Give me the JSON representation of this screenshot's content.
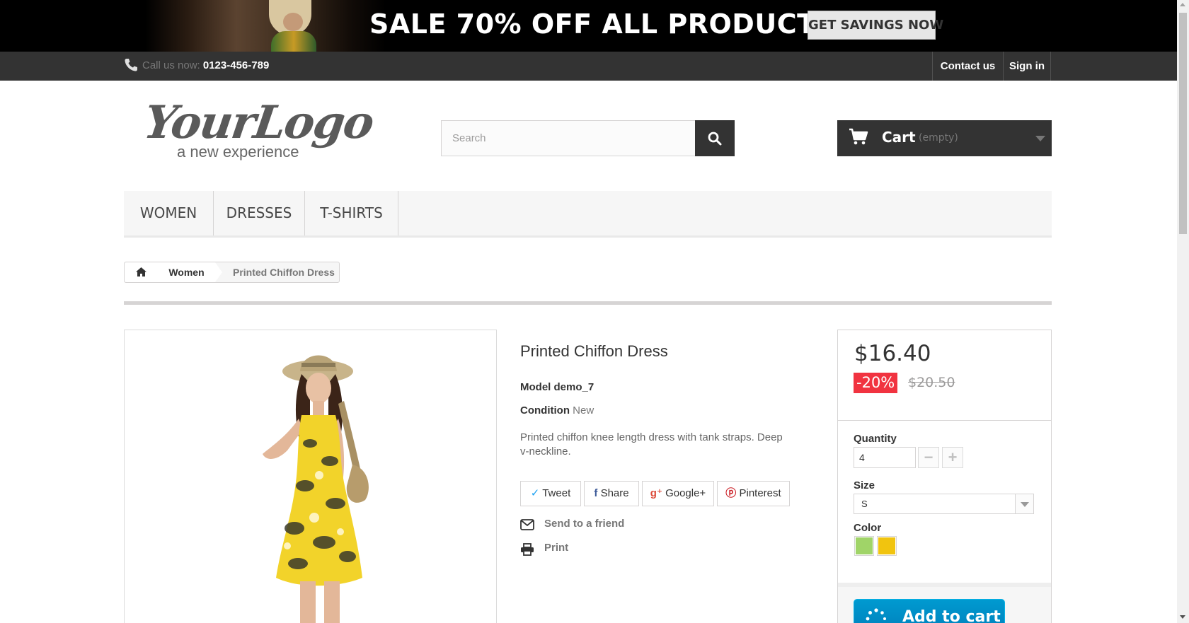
{
  "banner": {
    "headline": "SALE 70% OFF ALL PRODUCTS",
    "button_label": "GET SAVINGS NOW"
  },
  "topnav": {
    "call_label": "Call us now:",
    "phone": "0123-456-789",
    "contact_label": "Contact us",
    "signin_label": "Sign in",
    "icons": [
      "phone-icon"
    ]
  },
  "header": {
    "logo_text": "YourLogo",
    "logo_tagline": "a new experience",
    "search_placeholder": "Search",
    "cart_label": "Cart",
    "cart_status": "(empty)",
    "icons": [
      "search-icon",
      "cart-icon",
      "caret-down-icon"
    ]
  },
  "menu": {
    "items": [
      "WOMEN",
      "DRESSES",
      "T-SHIRTS"
    ]
  },
  "breadcrumb": {
    "items": [
      "Women",
      "Printed Chiffon Dress"
    ],
    "icons": [
      "home-icon"
    ]
  },
  "product": {
    "title": "Printed Chiffon Dress",
    "model_label": "Model",
    "model_value": "demo_7",
    "condition_label": "Condition",
    "condition_value": "New",
    "description": "Printed chiffon knee length dress with tank straps. Deep v-neckline.",
    "share_buttons": [
      "Tweet",
      "Share",
      "Google+",
      "Pinterest"
    ],
    "send_to_friend": "Send to a friend",
    "print": "Print"
  },
  "buy": {
    "price": "$16.40",
    "discount": "-20%",
    "old_price": "$20.50",
    "quantity_label": "Quantity",
    "quantity_value": "4",
    "size_label": "Size",
    "size_value": "S",
    "color_label": "Color",
    "colors": [
      "#a0d468",
      "#f1c40f"
    ],
    "add_to_cart": "Add to cart"
  },
  "colors": {
    "banner_bg": "#000000",
    "nav_bg": "#333333",
    "discount_red": "#f13340",
    "cart_button_blue": "#0088c7"
  }
}
